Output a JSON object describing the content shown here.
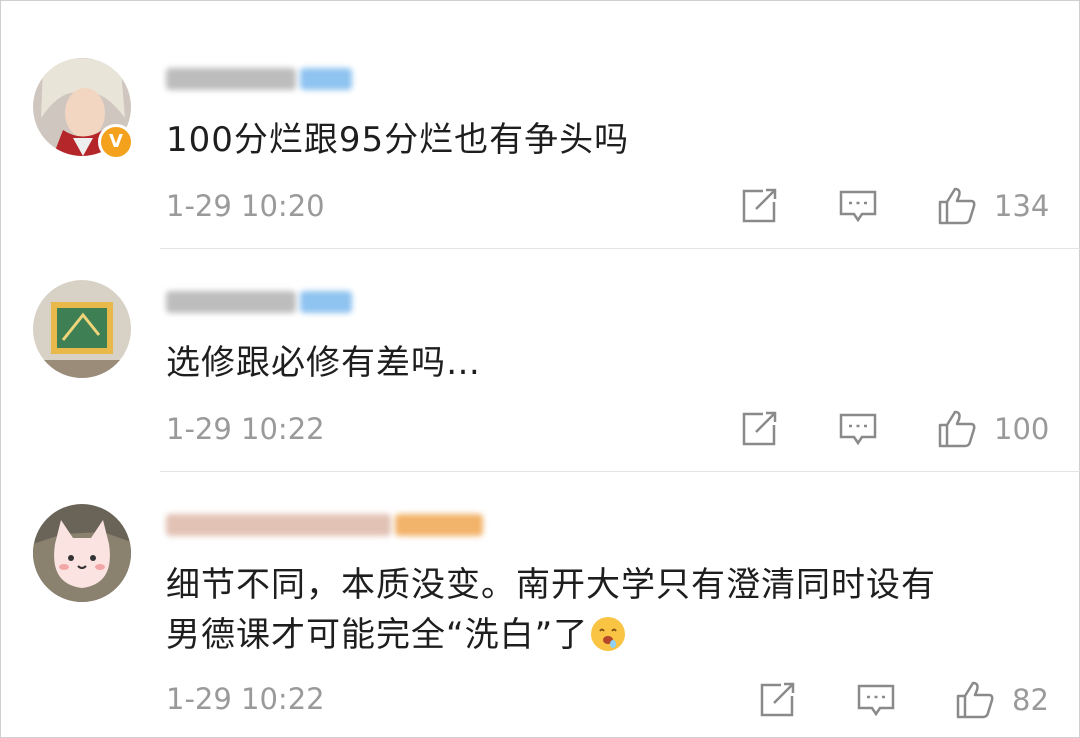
{
  "comments": [
    {
      "text": "100分烂跟95分烂也有争头吗",
      "time": "1-29 10:20",
      "likes": "134",
      "verified_badge": "V"
    },
    {
      "text": "选修跟必修有差吗…",
      "time": "1-29 10:22",
      "likes": "100"
    },
    {
      "text_line1": "细节不同，本质没变。南开大学只有澄清同时设有",
      "text_line2": "男德课才可能完全“洗白”了",
      "time": "1-29 10:22",
      "likes": "82"
    }
  ],
  "icons": {
    "share": "share-icon",
    "reply": "comment-icon",
    "like": "thumbs-up-icon",
    "emoji": "drooling-face-emoji"
  },
  "colors": {
    "meta_gray": "#9a9a9a",
    "badge_orange": "#f4a21d",
    "username_blue_blur": "#8fc3f0",
    "divider": "#e4e4e4"
  }
}
